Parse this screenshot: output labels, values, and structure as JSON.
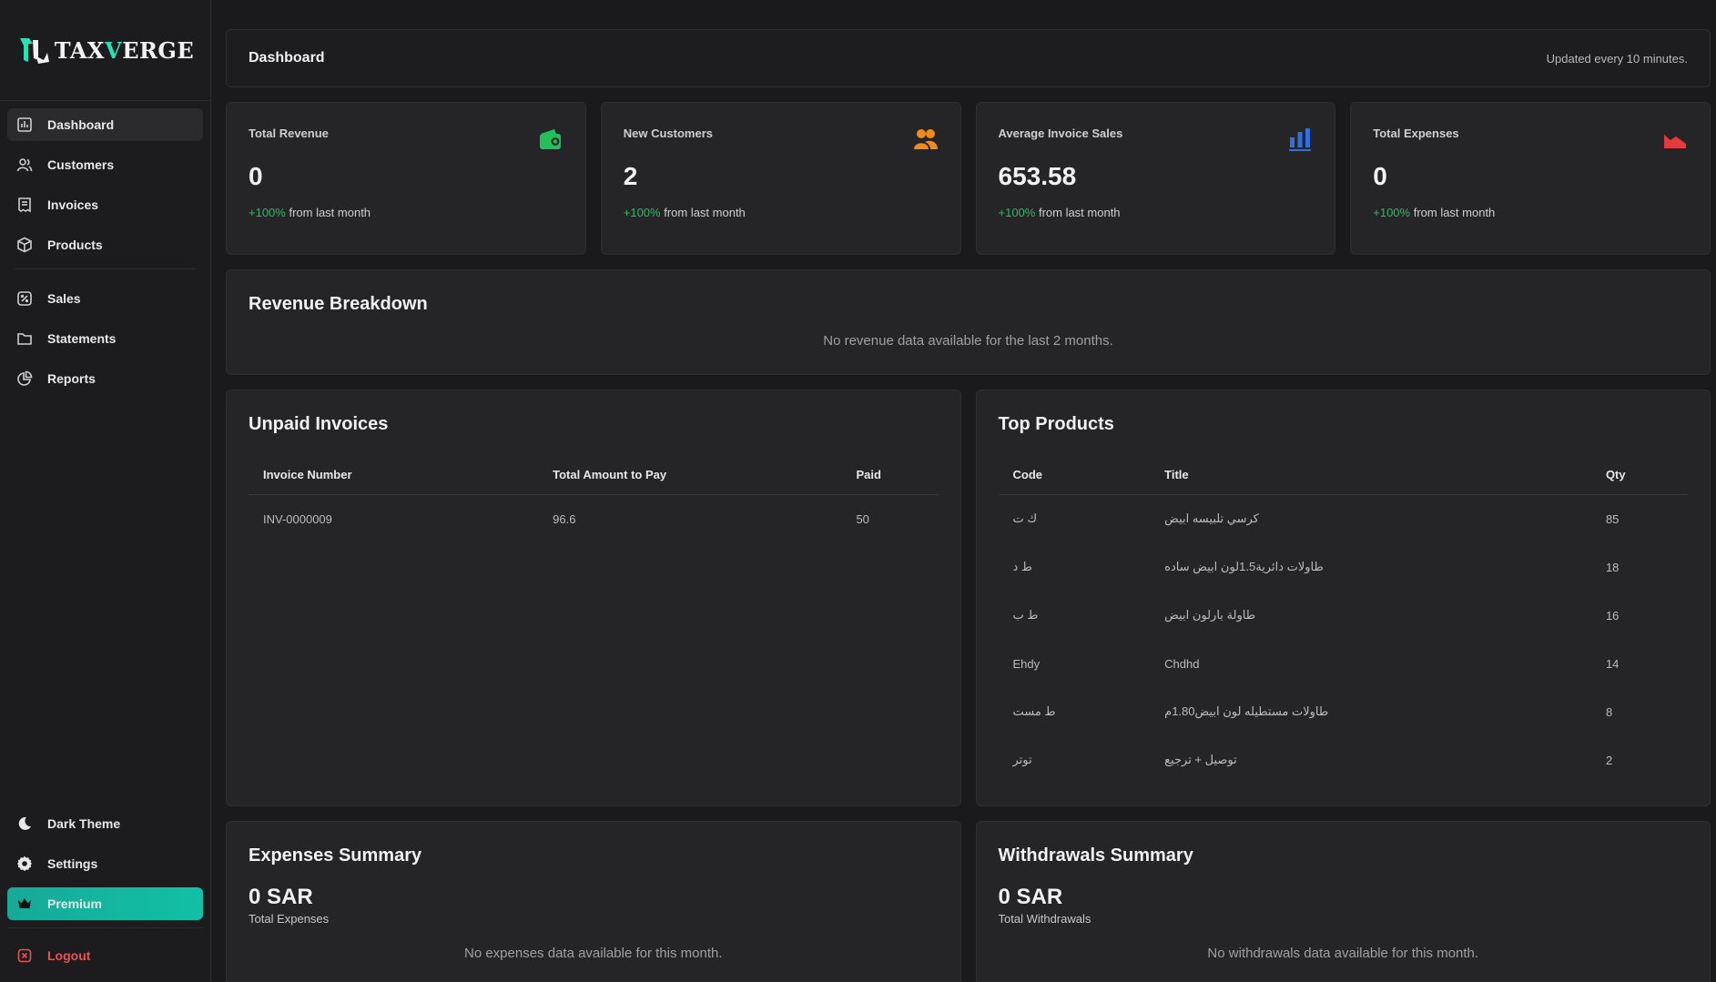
{
  "brand": {
    "name_prefix": "TAX",
    "name_v": "V",
    "name_suffix": "ERGE"
  },
  "sidebar": {
    "items": [
      {
        "label": "Dashboard",
        "icon": "chart-bar-icon"
      },
      {
        "label": "Customers",
        "icon": "users-icon"
      },
      {
        "label": "Invoices",
        "icon": "receipt-icon"
      },
      {
        "label": "Products",
        "icon": "box-icon"
      },
      {
        "label": "Sales",
        "icon": "percent-icon"
      },
      {
        "label": "Statements",
        "icon": "folder-icon"
      },
      {
        "label": "Reports",
        "icon": "pie-chart-icon"
      }
    ],
    "bottom": {
      "theme": "Dark Theme",
      "settings": "Settings",
      "premium": "Premium",
      "logout": "Logout"
    }
  },
  "header": {
    "title": "Dashboard",
    "updated": "Updated every 10 minutes."
  },
  "stats": [
    {
      "label": "Total Revenue",
      "value": "0",
      "pct": "+100%",
      "suffix": " from last month",
      "icon": "wallet-icon",
      "color": "#22c05a"
    },
    {
      "label": "New Customers",
      "value": "2",
      "pct": "+100%",
      "suffix": " from last month",
      "icon": "users-icon",
      "color": "#f08a1c"
    },
    {
      "label": "Average Invoice Sales",
      "value": "653.58",
      "pct": "+100%",
      "suffix": " from last month",
      "icon": "bar-chart-icon",
      "color": "#2f6fe6"
    },
    {
      "label": "Total Expenses",
      "value": "0",
      "pct": "+100%",
      "suffix": " from last month",
      "icon": "area-chart-icon",
      "color": "#e33b3b"
    }
  ],
  "revenue": {
    "title": "Revenue Breakdown",
    "empty": "No revenue data available for the last 2 months."
  },
  "unpaid": {
    "title": "Unpaid Invoices",
    "columns": [
      "Invoice Number",
      "Total Amount to Pay",
      "Paid"
    ],
    "rows": [
      [
        "INV-0000009",
        "96.6",
        "50"
      ]
    ]
  },
  "top_products": {
    "title": "Top Products",
    "columns": [
      "Code",
      "Title",
      "Qty"
    ],
    "rows": [
      [
        "ك ت",
        "كرسي تلبيسه ابيض",
        "85"
      ],
      [
        "ط د",
        "طاولات دائرية1.5لون ابيض ساده",
        "18"
      ],
      [
        "ط ب",
        "طاولة بارلون ابيض",
        "16"
      ],
      [
        "Ehdy",
        "Chdhd",
        "14"
      ],
      [
        "ط مست",
        "طاولات مستطيله لون ابيض1.80م",
        "8"
      ],
      [
        "توتر",
        "توصيل + ترجيع",
        "2"
      ]
    ]
  },
  "expenses": {
    "title": "Expenses Summary",
    "amount": "0 SAR",
    "sub": "Total Expenses",
    "empty": "No expenses data available for this month."
  },
  "withdrawals": {
    "title": "Withdrawals Summary",
    "amount": "0 SAR",
    "sub": "Total Withdrawals",
    "empty": "No withdrawals data available for this month."
  }
}
